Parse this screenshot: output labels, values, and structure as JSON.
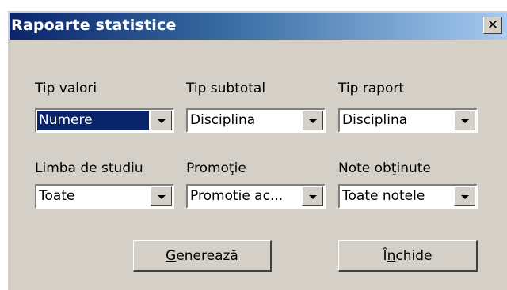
{
  "window": {
    "title": "Rapoarte statistice"
  },
  "fields": [
    {
      "label": "Tip valori",
      "value": "Numere"
    },
    {
      "label": "Tip subtotal",
      "value": "Disciplina"
    },
    {
      "label": "Tip raport",
      "value": "Disciplina"
    },
    {
      "label": "Limba de studiu",
      "value": "Toate"
    },
    {
      "label": "Promoţie",
      "value": "Promotie ac..."
    },
    {
      "label": "Note obţinute",
      "value": "Toate notele"
    }
  ],
  "buttons": {
    "generate": {
      "mnemonic": "G",
      "rest": "enerează"
    },
    "close": {
      "pre": "Î",
      "mnemonic": "n",
      "rest": "chide"
    }
  },
  "icons": {
    "close": "close-icon",
    "dropdown": "chevron-down-icon"
  }
}
